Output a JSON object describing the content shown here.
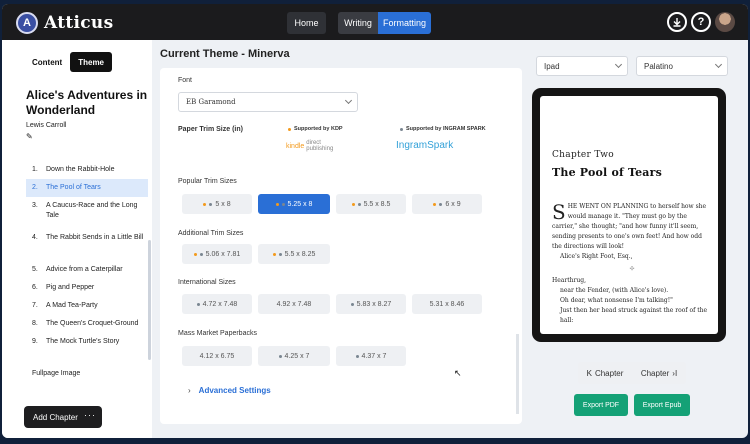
{
  "app": {
    "name": "Atticus",
    "logo_mark": "A"
  },
  "topbar": {
    "home_label": "Home",
    "writing_label": "Writing",
    "formatting_label": "Formatting",
    "download_icon": "download-icon",
    "help_icon": "help-icon",
    "help_glyph": "?"
  },
  "sidebar": {
    "tabs": {
      "content": "Content",
      "theme": "Theme"
    },
    "book_title": "Alice's Adventures in Wonderland",
    "author": "Lewis Carroll",
    "chapters": [
      {
        "num": "1.",
        "title": "Down the Rabbit-Hole"
      },
      {
        "num": "2.",
        "title": "The Pool of Tears"
      },
      {
        "num": "3.",
        "title": "A Caucus-Race and the Long Tale"
      },
      {
        "num": "4.",
        "title": "The Rabbit Sends in a Little Bill"
      },
      {
        "num": "5.",
        "title": "Advice from a Caterpillar"
      },
      {
        "num": "6.",
        "title": "Pig and Pepper"
      },
      {
        "num": "7.",
        "title": "A Mad Tea-Party"
      },
      {
        "num": "8.",
        "title": "The Queen's Croquet-Ground"
      },
      {
        "num": "9.",
        "title": "The Mock Turtle's Story"
      }
    ],
    "active_chapter": 1,
    "fullpage": "Fullpage Image",
    "add_chapter": "Add Chapter",
    "more_glyph": "···"
  },
  "main": {
    "title": "Current Theme - Minerva",
    "font_label": "Font",
    "font_value": "EB Garamond",
    "trim_label": "Paper Trim Size (in)",
    "supported_kdp": "Supported by KDP",
    "supported_ingram": "Supported by INGRAM SPARK",
    "kdp_logo": {
      "kindle": "kindle",
      "dp1": "direct",
      "dp2": "publishing"
    },
    "ingram_logo": "IngramSpark",
    "popular_label": "Popular Trim Sizes",
    "popular": [
      "5 x 8",
      "5.25 x 8",
      "5.5 x 8.5",
      "6 x 9"
    ],
    "additional_label": "Additional Trim Sizes",
    "additional": [
      "5.06 x 7.81",
      "5.5 x 8.25"
    ],
    "international_label": "International Sizes",
    "international": [
      "4.72 x 7.48",
      "4.92 x 7.48",
      "5.83 x 8.27",
      "5.31 x 8.46"
    ],
    "mass_label": "Mass Market Paperbacks",
    "mass": [
      "4.12 x 6.75",
      "4.25 x 7",
      "4.37 x 7"
    ],
    "advanced": "Advanced Settings",
    "advanced_arrow": "›",
    "cursor_glyph": "↖"
  },
  "preview": {
    "device": "Ipad",
    "font": "Palatino",
    "chapter_num": "Chapter Two",
    "chapter_title": "The Pool of Tears",
    "dropcap": "S",
    "p1": "HE WENT ON PLANNING to herself how she would manage it. \"They must go by the carrier,\" she thought; \"and how funny it'll seem, sending presents to one's own feet! And how odd the directions will look!",
    "p2": "Alice's Right Foot, Esq.,",
    "ornament": "⊹",
    "p3": "Hearthrug,",
    "p4": "near the Fender, (with Alice's love).",
    "p5": "Oh dear, what nonsense I'm talking!\"",
    "p6": "Just then her head struck against the roof of the hall:",
    "prev_label": "Chapter",
    "next_label": "Chapter",
    "prev_glyph": "K",
    "next_glyph": "›I",
    "export_pdf": "Export PDF",
    "export_epub": "Export Epub"
  },
  "colors": {
    "accent": "#2a6fd6",
    "export": "#14a176",
    "kdp": "#f39a1c",
    "ingram": "#33a1d8"
  }
}
